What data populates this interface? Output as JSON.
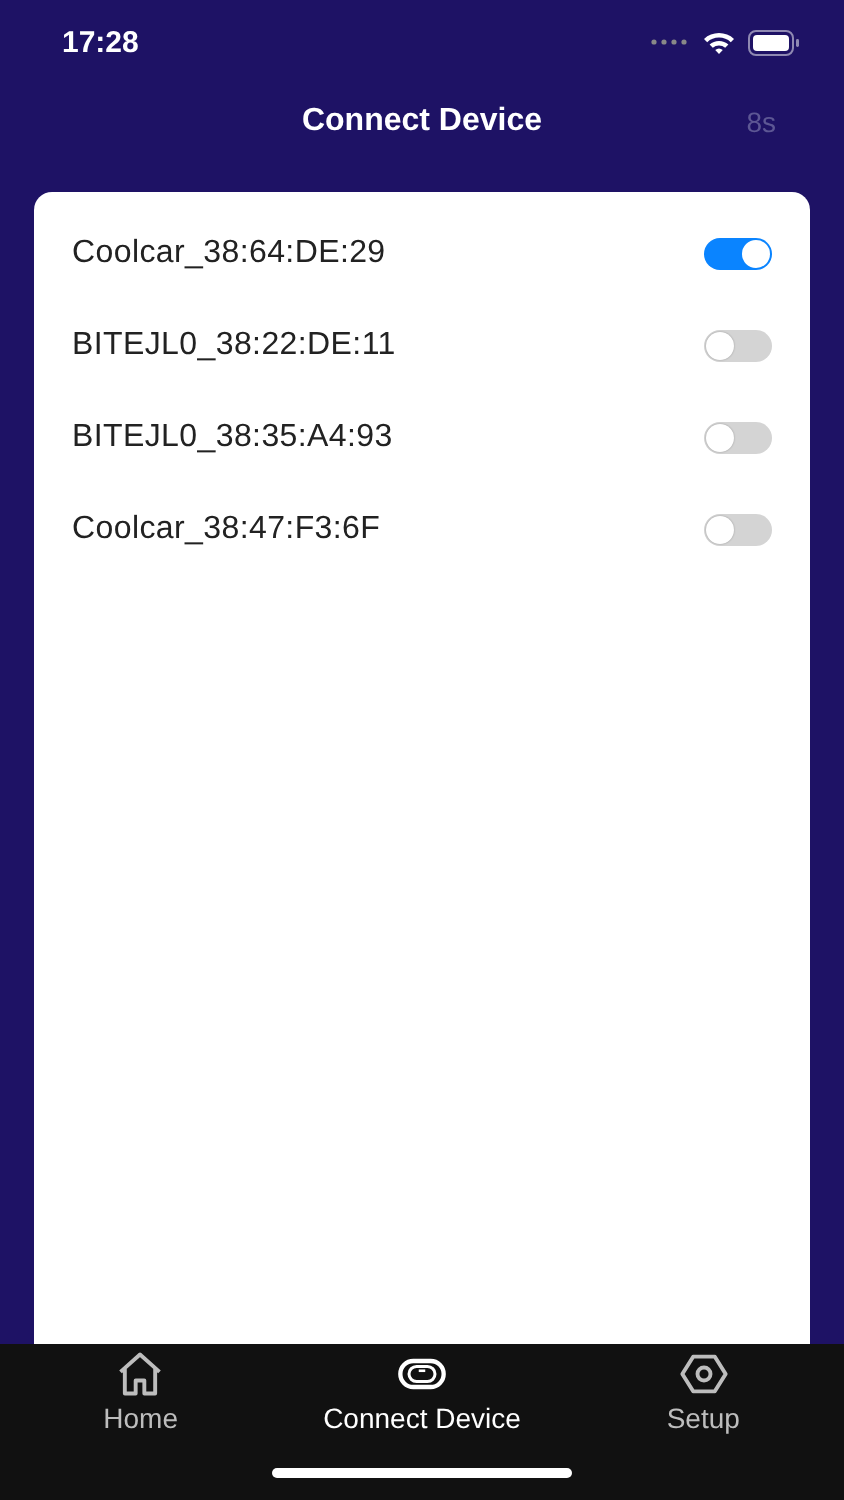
{
  "status_bar": {
    "time": "17:28"
  },
  "header": {
    "title": "Connect Device",
    "countdown": "8s"
  },
  "devices": [
    {
      "name": "Coolcar_38:64:DE:29",
      "on": true
    },
    {
      "name": "BITEJL0_38:22:DE:11",
      "on": false
    },
    {
      "name": "BITEJL0_38:35:A4:93",
      "on": false
    },
    {
      "name": "Coolcar_38:47:F3:6F",
      "on": false
    }
  ],
  "tabs": [
    {
      "label": "Home",
      "kind": "home",
      "selected": false
    },
    {
      "label": "Connect Device",
      "kind": "device",
      "selected": true
    },
    {
      "label": "Setup",
      "kind": "setup",
      "selected": false
    }
  ]
}
